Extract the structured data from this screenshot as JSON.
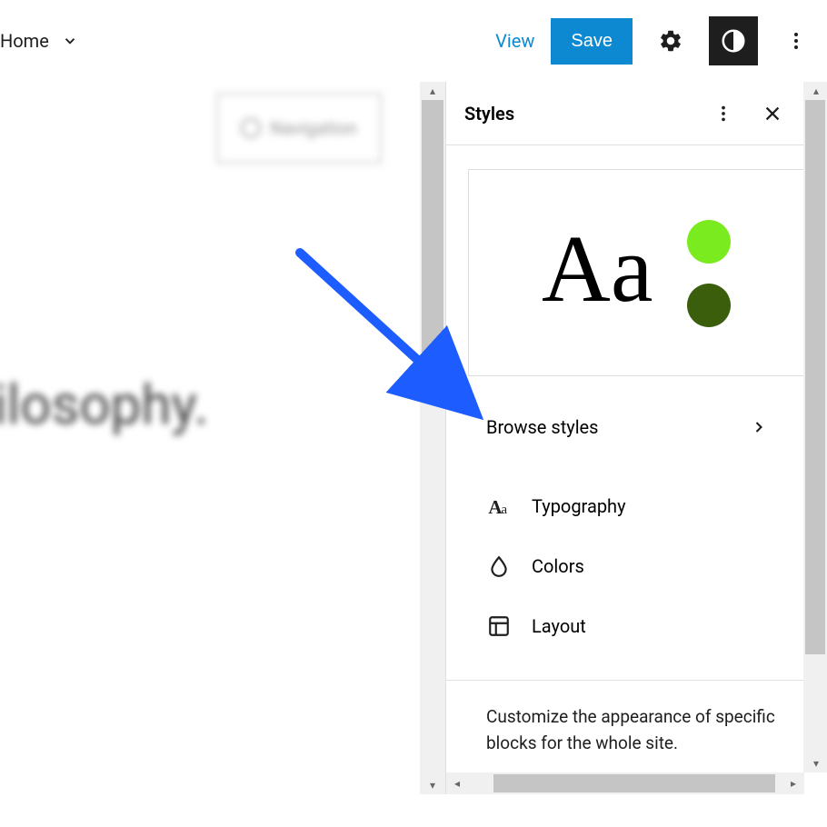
{
  "topbar": {
    "home_label": "Home",
    "view_label": "View",
    "save_label": "Save"
  },
  "canvas": {
    "nav_label": "Navigation",
    "headline": "hilosophy."
  },
  "sidebar": {
    "title": "Styles",
    "preview_text": "Aa",
    "preview_color_1": "#7aeb1e",
    "preview_color_2": "#3a5e0b",
    "browse_label": "Browse styles",
    "options": [
      {
        "label": "Typography"
      },
      {
        "label": "Colors"
      },
      {
        "label": "Layout"
      }
    ],
    "description": "Customize the appearance of specific blocks for the whole site."
  }
}
